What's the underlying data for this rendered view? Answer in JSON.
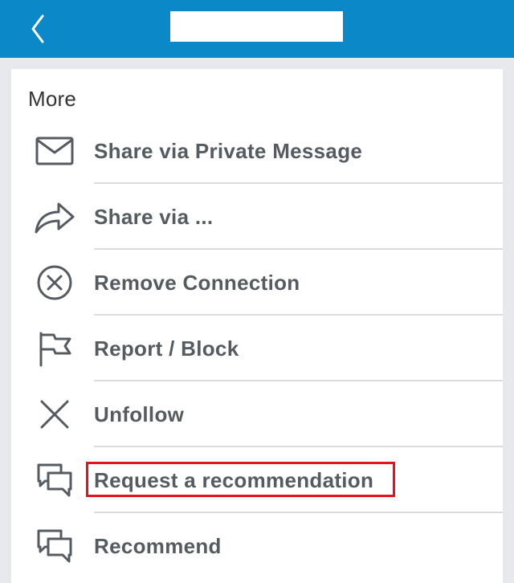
{
  "header": {
    "back_icon": "chevron-left-icon",
    "title": ""
  },
  "more_label": "More",
  "menu": {
    "items": [
      {
        "label": "Share via Private Message",
        "icon": "envelope-icon"
      },
      {
        "label": "Share via ...",
        "icon": "share-arrow-icon"
      },
      {
        "label": "Remove Connection",
        "icon": "remove-circle-icon"
      },
      {
        "label": "Report / Block",
        "icon": "flag-icon"
      },
      {
        "label": "Unfollow",
        "icon": "close-x-icon"
      },
      {
        "label": "Request a recommendation",
        "icon": "chat-bubbles-icon",
        "highlighted": true
      },
      {
        "label": "Recommend",
        "icon": "chat-bubbles-icon"
      }
    ]
  },
  "colors": {
    "header": "#0a88c8",
    "background": "#e7e9ec",
    "highlight_border": "#e3141b",
    "item_text": "#555b60"
  }
}
